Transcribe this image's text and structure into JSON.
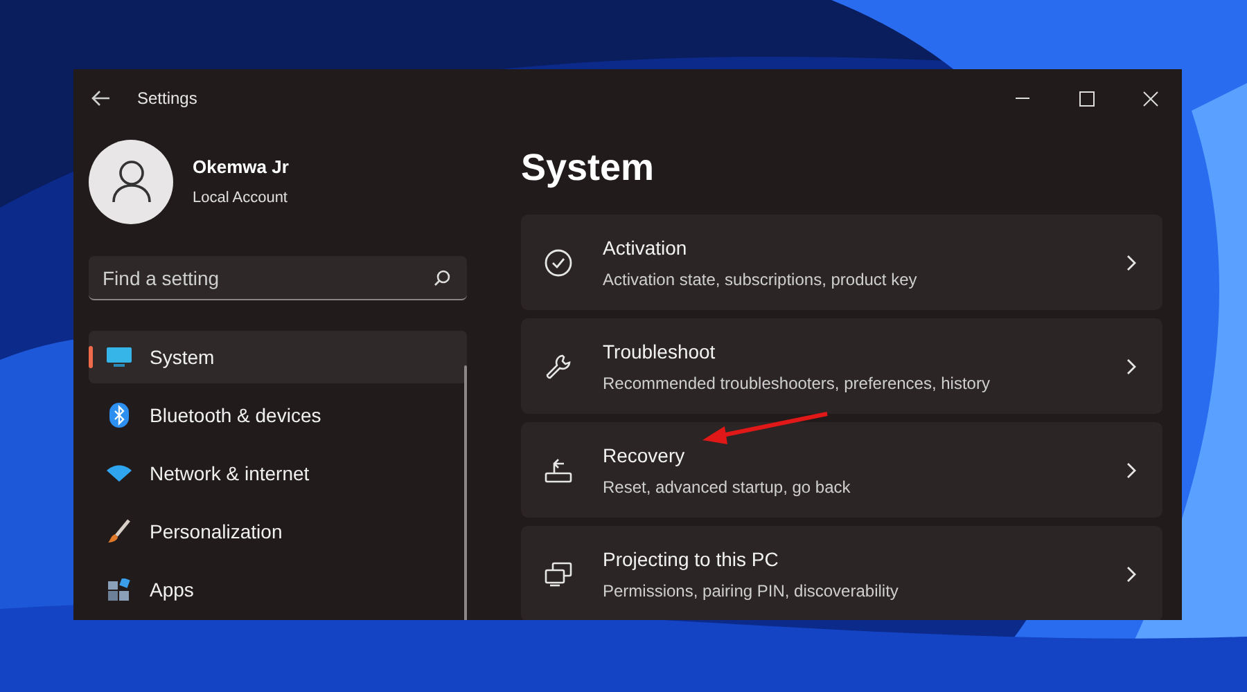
{
  "window": {
    "title": "Settings"
  },
  "account": {
    "name": "Okemwa Jr",
    "type": "Local Account"
  },
  "search": {
    "placeholder": "Find a setting"
  },
  "nav_items": [
    {
      "label": "System",
      "selected": true
    },
    {
      "label": "Bluetooth & devices",
      "selected": false
    },
    {
      "label": "Network & internet",
      "selected": false
    },
    {
      "label": "Personalization",
      "selected": false
    },
    {
      "label": "Apps",
      "selected": false
    }
  ],
  "page_title": "System",
  "cards": [
    {
      "title": "Activation",
      "description": "Activation state, subscriptions, product key"
    },
    {
      "title": "Troubleshoot",
      "description": "Recommended troubleshooters, preferences, history"
    },
    {
      "title": "Recovery",
      "description": "Reset, advanced startup, go back"
    },
    {
      "title": "Projecting to this PC",
      "description": "Permissions, pairing PIN, discoverability"
    }
  ]
}
